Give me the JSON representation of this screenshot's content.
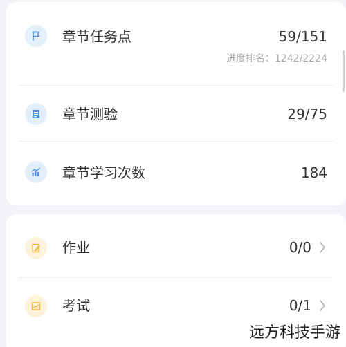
{
  "summary": {
    "chapter_tasks": {
      "label": "章节任务点",
      "value": "59/151",
      "rank": "进度排名：1242/2224",
      "icon": "flag-icon"
    },
    "chapter_quiz": {
      "label": "章节测验",
      "value": "29/75",
      "icon": "document-icon"
    },
    "chapter_study": {
      "label": "章节学习次数",
      "value": "184",
      "icon": "bar-chart-icon"
    }
  },
  "assignments": {
    "homework": {
      "label": "作业",
      "value": "0/0",
      "icon": "edit-icon"
    },
    "exam": {
      "label": "考试",
      "value": "0/1",
      "icon": "exam-icon"
    }
  },
  "watermark": "远方科技手游",
  "colors": {
    "background": "#f3f3f8",
    "card": "#ffffff",
    "icon_blue": "#4a90e2",
    "icon_blue_bg": "#e4effc",
    "icon_yellow": "#f5b537",
    "icon_yellow_bg": "#fdf3dc",
    "text": "#333333",
    "muted": "#aaaaaa"
  }
}
